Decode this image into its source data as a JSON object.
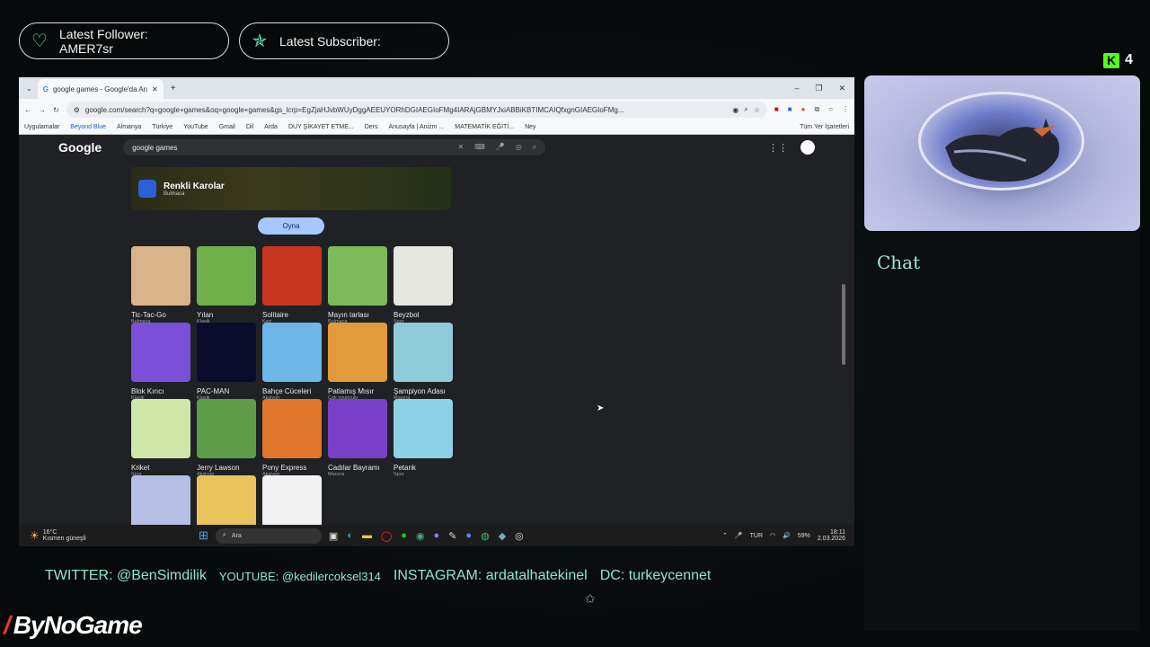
{
  "overlay": {
    "follower_label": "Latest Follower:",
    "follower_name": "AMER7sr",
    "subscriber_label": "Latest Subscriber:",
    "subscriber_name": "",
    "kick_count": "4",
    "chat_title": "Chat",
    "socials": {
      "twitter": "TWITTER: @BenSimdilik",
      "youtube": "YOUTUBE: @kedilercoksel314",
      "instagram": "INSTAGRAM: ardatalhatekinel",
      "discord": "DC: turkeycennet"
    },
    "brand": "ByNoGame"
  },
  "browser": {
    "tab_title": "google games - Google'da Ara",
    "url": "google.com/search?q=google+games&oq=google+games&gs_lcrp=EgZjaHJvbWUyDggAEEUYORhDGIAEGIoFMg4IARAjGBMYJxiABBiKBTIMCAIQfxgnGIAEGIoFMg...",
    "bookmarks": [
      "Uygulamalar",
      "Beyond Blue",
      "Almanya",
      "Türkiye",
      "YouTube",
      "Gmail",
      "Dil",
      "Arda",
      "DUY ŞİKAYET ETME...",
      "Ders",
      "Anusayfa | Anizm ...",
      "MATEMATİK EĞİTİ...",
      "Ney"
    ],
    "all_bookmarks": "Tüm Yer İşaretleri"
  },
  "google": {
    "logo": "Google",
    "query": "google games",
    "featured_title": "Renkli Karolar",
    "featured_category": "Bulmaca",
    "play_button": "Oyna",
    "games": [
      {
        "name": "Tic-Tac-Go",
        "category": "Bulmaca",
        "color": "#d9b48a"
      },
      {
        "name": "Yılan",
        "category": "Klasik",
        "color": "#6fb04a"
      },
      {
        "name": "Solitaire",
        "category": "Kart",
        "color": "#c9361f"
      },
      {
        "name": "Mayın tarlası",
        "category": "Bulmaca",
        "color": "#7dbb5a"
      },
      {
        "name": "Beyzbol",
        "category": "Spor",
        "color": "#e6e6e0"
      },
      {
        "name": "Blok Kırıcı",
        "category": "Klasik",
        "color": "#7b4fd8"
      },
      {
        "name": "PAC-MAN",
        "category": "Klasik",
        "color": "#0b0b2c"
      },
      {
        "name": "Bahçe Cüceleri",
        "category": "Aksiyon",
        "color": "#6cb6e8"
      },
      {
        "name": "Patlamış Mısır",
        "category": "Çok oyunculu",
        "color": "#e39a3b"
      },
      {
        "name": "Şampiyon Adası",
        "category": "Macera",
        "color": "#8fcbd9"
      },
      {
        "name": "Kriket",
        "category": "Spor",
        "color": "#cfe7a6"
      },
      {
        "name": "Jerry Lawson",
        "category": "Aksiyon",
        "color": "#5e9d48"
      },
      {
        "name": "Pony Express",
        "category": "Aksiyon",
        "color": "#e0772b"
      },
      {
        "name": "Cadılar Bayramı",
        "category": "Macera",
        "color": "#7a3fc9"
      },
      {
        "name": "Petank",
        "category": "Spor",
        "color": "#8cd1e6"
      },
      {
        "name": "",
        "category": "",
        "color": "#b5bfe6"
      },
      {
        "name": "",
        "category": "",
        "color": "#e9c45b"
      },
      {
        "name": "",
        "category": "",
        "color": "#f2f2f2"
      }
    ]
  },
  "taskbar": {
    "temperature": "16°C",
    "weather": "Kısmen güneşli",
    "search_placeholder": "Ara",
    "language": "TUR",
    "battery": "59%",
    "time": "18:11",
    "date": "2.03.2026"
  }
}
